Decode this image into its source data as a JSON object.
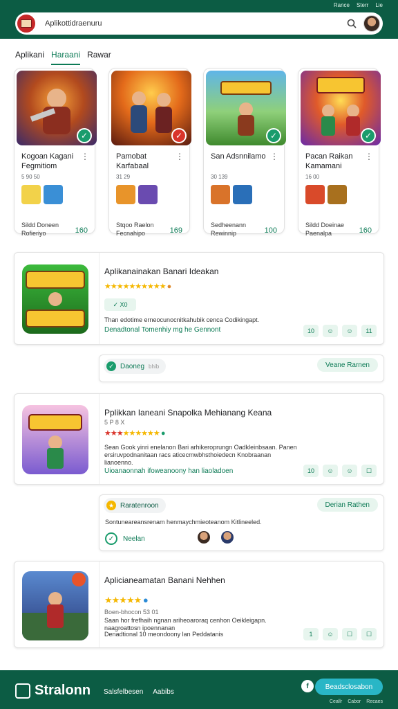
{
  "header": {
    "links": [
      "Rance",
      "Sterr",
      "Lie"
    ],
    "search_value": "Aplikottidraenuru"
  },
  "tabs": [
    {
      "label": "Aplikani",
      "active": false
    },
    {
      "label": "Haraani",
      "active": true
    },
    {
      "label": "Rawar",
      "active": false
    }
  ],
  "cards": [
    {
      "title": "Kogoan Kagani Fegmitiom",
      "meta": "5 90 50",
      "sub": "Sildd Doneen Rofieriyo",
      "price": "160"
    },
    {
      "title": "Pamobat Karfabaal",
      "meta": "31 29",
      "sub": "Stqoo Raelon Fecnahipo",
      "price": "169"
    },
    {
      "title": "San Adsnnilamo",
      "meta": "30 139",
      "sub": "Sedheenann Rewinnip",
      "price": "100"
    },
    {
      "title": "Pacan Raikan Kamamani",
      "meta": "16 00",
      "sub": "Sildd Doeinae Paenalpa",
      "price": "160"
    }
  ],
  "sections": [
    {
      "title": "Aplikanainakan Banari Ideakan",
      "tags": "✓ X0",
      "body": "Than edotime erneocunocnitkahubik cenca Codikingapt.",
      "link": "Denadtonal Tomenhiy mg he Gennont",
      "actions": [
        "10",
        "☺",
        "☺",
        "11"
      ]
    },
    {
      "title": "Pplikkan Ianeani Snapolka Mehianang Keana",
      "meta": "5 P 8 X",
      "body": "Sean Gook yinri enelanon Bari arhikeroprungn Oadkleinbsaan. Panen ersiruvpodnanitaan racs aticecmwbhsthoiedecn Knobraanan lianoenno.",
      "link": "Uioanaonnah ifoweanoony han liaoladoen",
      "actions": [
        "10",
        "☺",
        "☺",
        "☐"
      ]
    },
    {
      "title": "Aplicianeamatan Banani Nehhen",
      "meta": "Boen-bhocon 53 01",
      "body": "Saan hor frefhaih ngnan ariheoaroraq cenhon Oeikleigapn. naagroattosn ipoennanan",
      "link": "Denadtional 10 meondoony lan Peddatanis",
      "actions": [
        "1",
        "☺",
        "☐",
        "☐"
      ]
    }
  ],
  "subbox1": {
    "chip_label": "Daoneg",
    "chip_sub": "bhib",
    "button": "Veane Rarnen"
  },
  "subbox2": {
    "chip_label": "Raratenroon",
    "body": "Sontuneareansrenam henmaychmieoteanom Kitlineeled.",
    "check_label": "Neelan",
    "button": "Derian Rathen"
  },
  "footer": {
    "brand": "Stralonn",
    "links": [
      "Salsfelbesen",
      "Aabibs"
    ],
    "cta": "Beadsclosabon",
    "bottom": [
      "Ceallr",
      "Cabor",
      "Recaes"
    ]
  },
  "colors": {
    "brand_green": "#0c5c44",
    "accent_green": "#0c7a55",
    "cta_teal": "#29b6c6",
    "star_gold": "#f5b700"
  }
}
